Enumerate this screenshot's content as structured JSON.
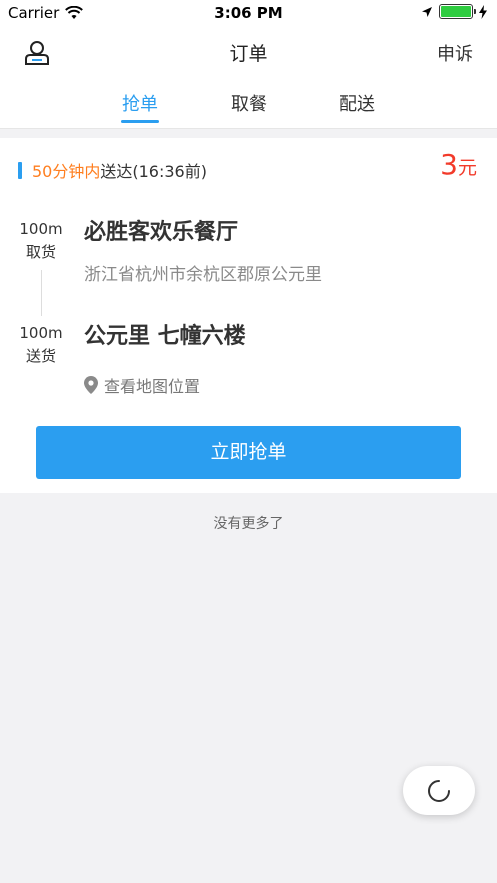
{
  "status_bar": {
    "carrier": "Carrier",
    "time": "3:06 PM"
  },
  "nav": {
    "title": "订单",
    "right_label": "申诉",
    "left_icon": "user-icon"
  },
  "tabs": [
    {
      "label": "抢单",
      "active": true
    },
    {
      "label": "取餐",
      "active": false
    },
    {
      "label": "配送",
      "active": false
    }
  ],
  "order": {
    "time_highlight": "50分钟内",
    "time_rest": "送达(16:36前)",
    "price_value": "3",
    "price_unit": "元",
    "pickup": {
      "distance": "100m",
      "label": "取货",
      "name": "必胜客欢乐餐厅",
      "address": "浙江省杭州市余杭区郡原公元里"
    },
    "delivery": {
      "distance": "100m",
      "label": "送货",
      "name": "公元里 七幢六楼",
      "map_link": "查看地图位置"
    },
    "grab_button": "立即抢单"
  },
  "list_footer": "没有更多了",
  "colors": {
    "accent": "#2b9ef0",
    "highlight": "#ff7e1f",
    "price": "#f23a2a"
  }
}
